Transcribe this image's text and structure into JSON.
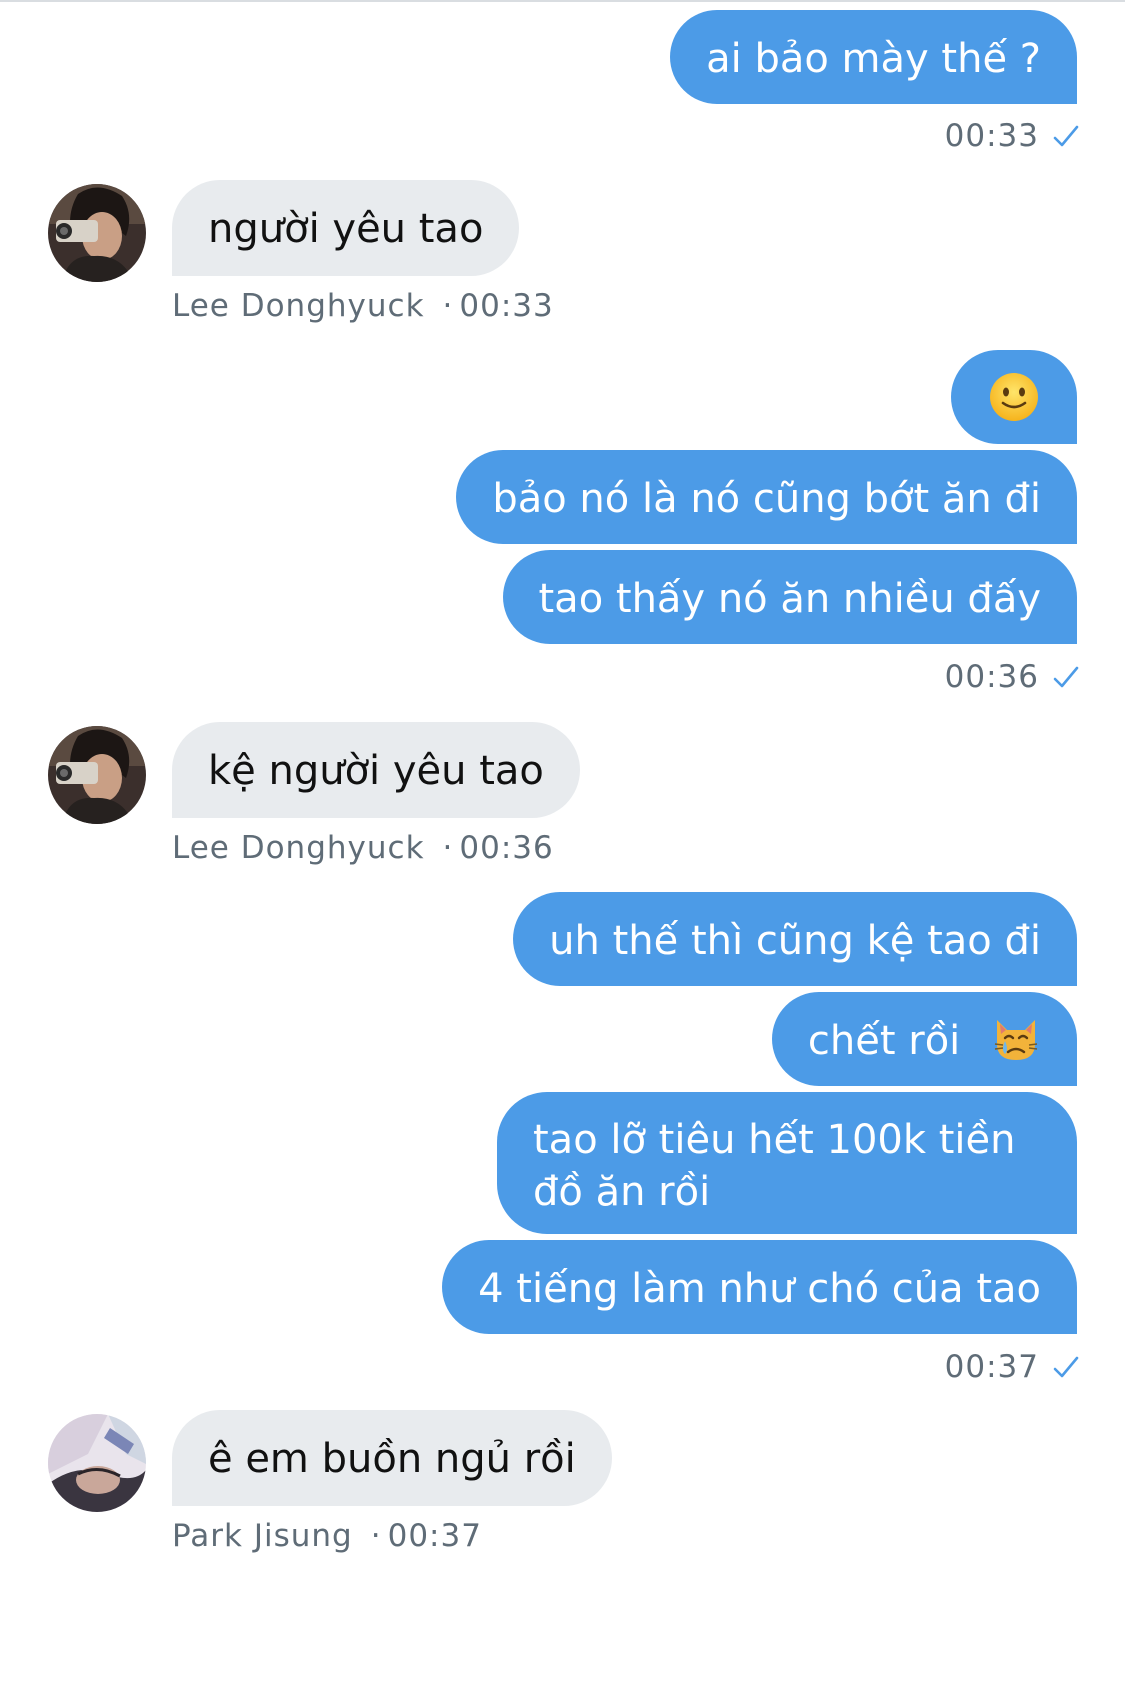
{
  "chat": {
    "messages": [
      {
        "text": "ai bảo mày thế ?"
      },
      {
        "text": "người yêu tao"
      },
      {
        "text": "🙂"
      },
      {
        "text": "bảo nó là nó cũng bớt ăn đi"
      },
      {
        "text": "tao thấy nó ăn nhiều đấy"
      },
      {
        "text": "kệ người yêu tao"
      },
      {
        "text": "uh thế thì cũng kệ tao đi"
      },
      {
        "text": "chết rồi"
      },
      {
        "text": "tao lỡ tiêu hết 100k tiền đồ ăn rồi"
      },
      {
        "text": "4 tiếng làm như chó của tao"
      },
      {
        "text": "ê em buồn ngủ rồi"
      }
    ],
    "sent_times": [
      "00:33",
      "00:36",
      "00:37"
    ],
    "received_meta": [
      {
        "sender": "Lee Donghyuck",
        "separator": "·",
        "time": "00:33"
      },
      {
        "sender": "Lee Donghyuck",
        "separator": "·",
        "time": "00:36"
      },
      {
        "sender": "Park Jisung",
        "separator": "·",
        "time": "00:37"
      }
    ]
  },
  "icons": {
    "read_receipt": "check-icon",
    "crying_cat": "crying-cat-icon",
    "slight_smile": "slightly-smiling-face"
  },
  "colors": {
    "outgoing_bubble": "#4c9be7",
    "incoming_bubble": "#e8ebee",
    "meta_text": "#5f6c77",
    "check": "#4c9be7"
  }
}
